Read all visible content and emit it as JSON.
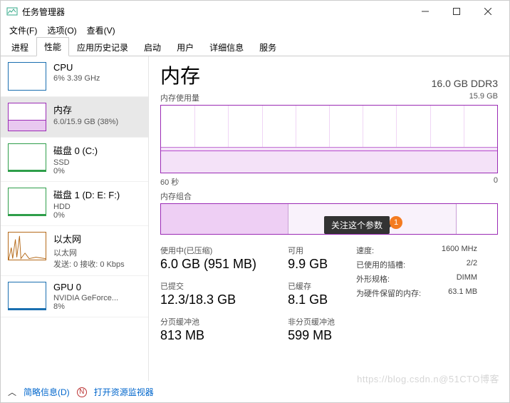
{
  "window": {
    "title": "任务管理器"
  },
  "menu": {
    "file": "文件(F)",
    "options": "选项(O)",
    "view": "查看(V)"
  },
  "tabs": [
    "进程",
    "性能",
    "应用历史记录",
    "启动",
    "用户",
    "详细信息",
    "服务"
  ],
  "active_tab": 1,
  "sidebar": {
    "items": [
      {
        "title": "CPU",
        "sub": "6% 3.39 GHz"
      },
      {
        "title": "内存",
        "sub": "6.0/15.9 GB (38%)"
      },
      {
        "title": "磁盘 0 (C:)",
        "sub1": "SSD",
        "sub2": "0%"
      },
      {
        "title": "磁盘 1 (D: E: F:)",
        "sub1": "HDD",
        "sub2": "0%"
      },
      {
        "title": "以太网",
        "sub1": "以太网",
        "sub2": "发送: 0 接收: 0 Kbps"
      },
      {
        "title": "GPU 0",
        "sub1": "NVIDIA GeForce...",
        "sub2": "8%"
      }
    ]
  },
  "detail": {
    "title": "内存",
    "right": "16.0 GB DDR3",
    "usage_label": "内存使用量",
    "usage_max": "15.9 GB",
    "axis_left": "60 秒",
    "axis_right": "0",
    "comp_label": "内存组合",
    "stats": {
      "inuse_label": "使用中(已压缩)",
      "inuse_value": "6.0 GB (951 MB)",
      "avail_label": "可用",
      "avail_value": "9.9 GB",
      "commit_label": "已提交",
      "commit_value": "12.3/18.3 GB",
      "cached_label": "已缓存",
      "cached_value": "8.1 GB",
      "paged_label": "分页缓冲池",
      "paged_value": "813 MB",
      "nonpaged_label": "非分页缓冲池",
      "nonpaged_value": "599 MB"
    },
    "right_stats": {
      "speed_l": "速度:",
      "speed_v": "1600 MHz",
      "slots_l": "已使用的插槽:",
      "slots_v": "2/2",
      "form_l": "外形规格:",
      "form_v": "DIMM",
      "reserved_l": "为硬件保留的内存:",
      "reserved_v": "63.1 MB"
    }
  },
  "tooltip": "关注这个参数",
  "badge": "1",
  "footer": {
    "less": "简略信息(D)",
    "open": "打开资源监视器"
  },
  "watermark": "https://blog.csdn.n@51CTO博客"
}
